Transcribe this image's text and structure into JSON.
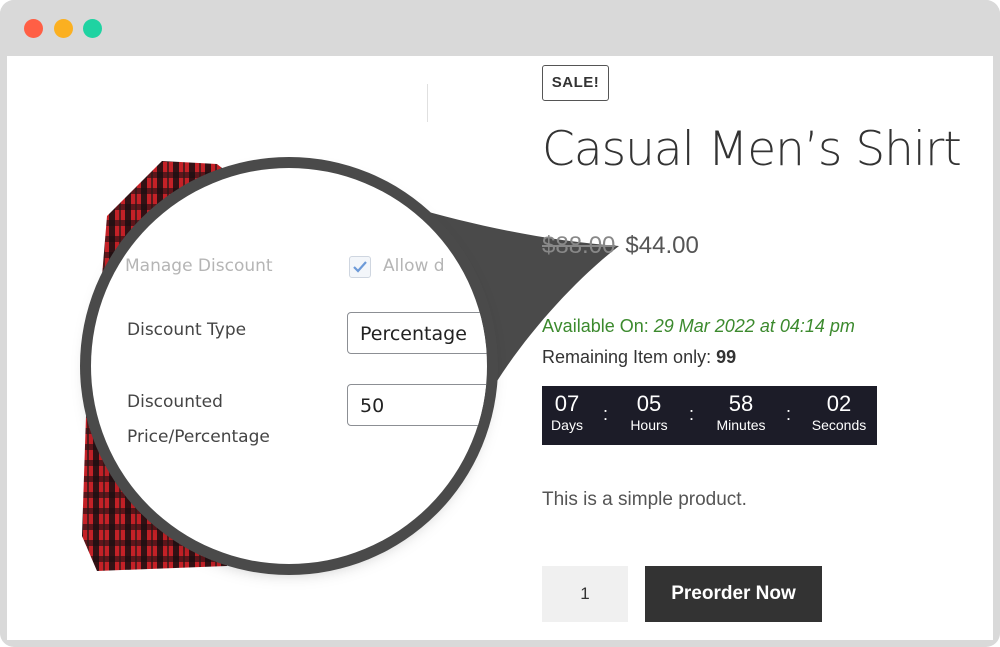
{
  "window": {
    "controls": [
      "close",
      "minimize",
      "maximize"
    ],
    "colors": {
      "close": "#ff5f45",
      "minimize": "#fbb021",
      "maximize": "#1fd3a2"
    }
  },
  "magnifier": {
    "manage_discount_label": "Manage Discount",
    "allow_label": "Allow d",
    "allow_checked": true,
    "discount_type_label": "Discount Type",
    "discount_type_value": "Percentage",
    "discounted_label_line1": "Discounted",
    "discounted_label_line2": "Price/Percentage",
    "discounted_value": "50"
  },
  "product": {
    "badge": "SALE!",
    "title": "Casual Men’s Shirt",
    "old_price": "$88.00",
    "price": "$44.00",
    "available_label": "Available On:",
    "available_date": "29 Mar 2022 at 04:14 pm",
    "remaining_label": "Remaining Item only:",
    "remaining_count": "99",
    "description": "This is a simple product.",
    "quantity": "1",
    "preorder_button": "Preorder Now",
    "accent_green": "#3c8a2e"
  },
  "countdown": {
    "days": "07",
    "days_label": "Days",
    "hours": "05",
    "hours_label": "Hours",
    "minutes": "58",
    "minutes_label": "Minutes",
    "seconds": "02",
    "seconds_label": "Seconds",
    "separator": ":"
  }
}
